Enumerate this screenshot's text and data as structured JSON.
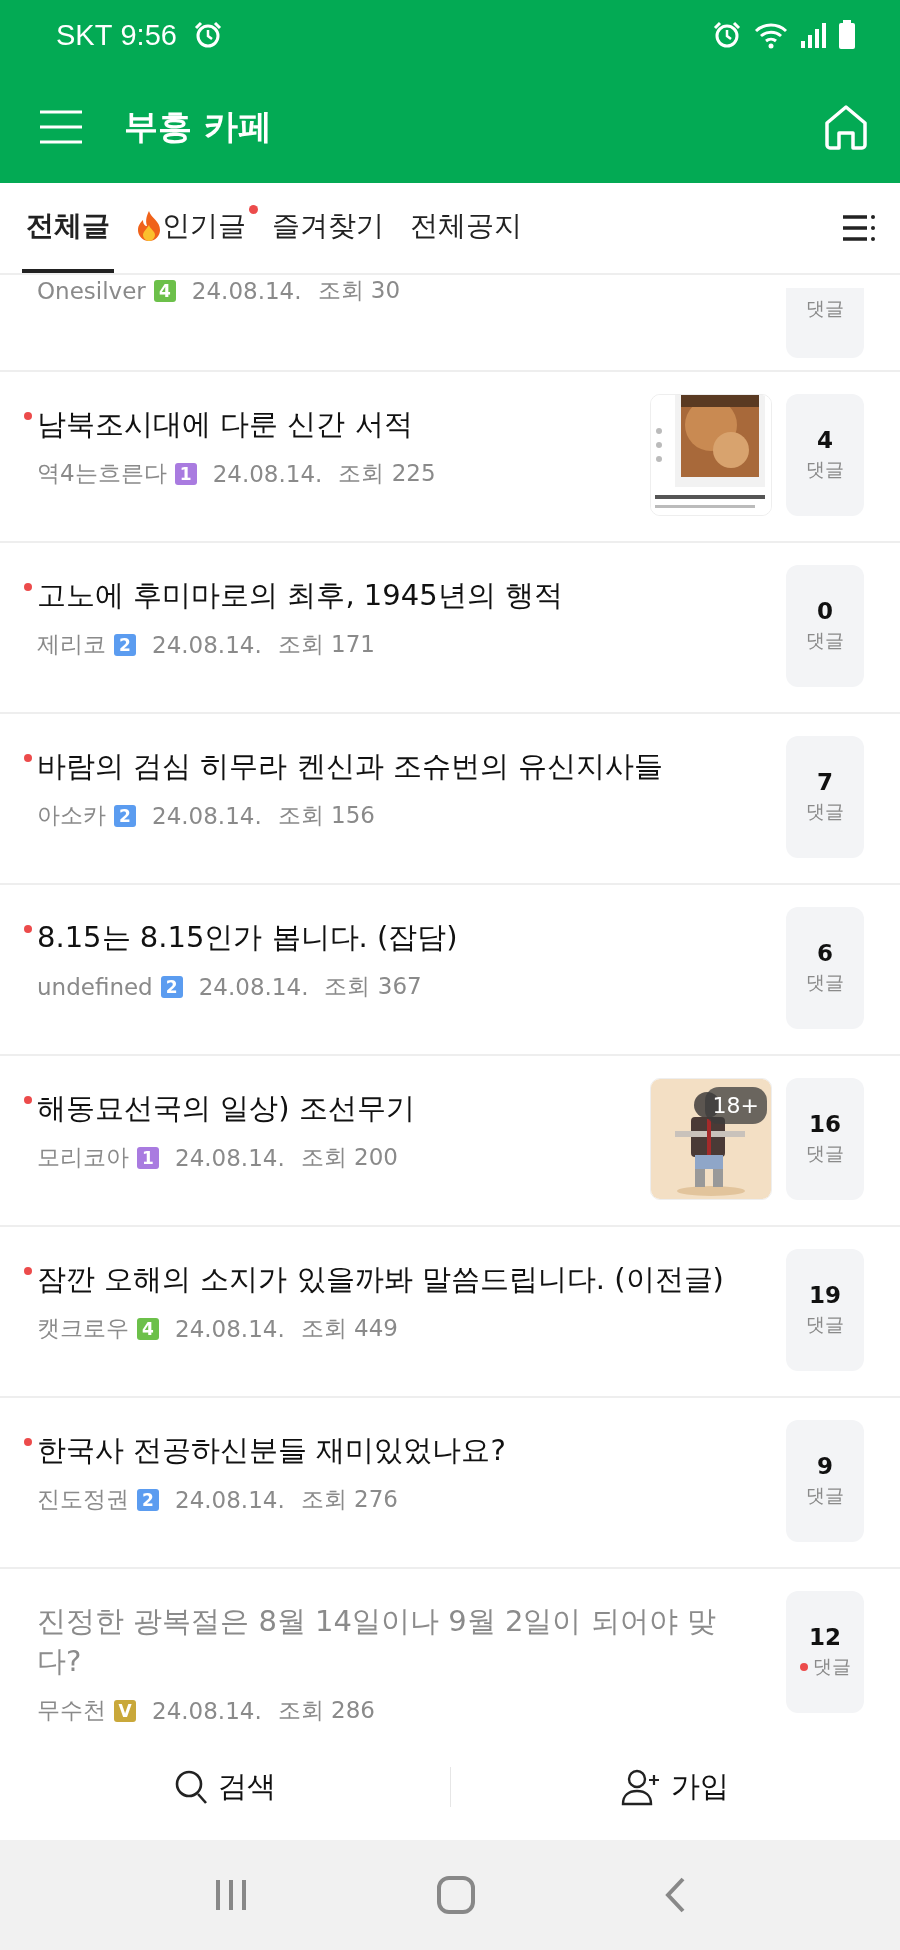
{
  "status_bar": {
    "carrier": "SKT",
    "time": "9:56"
  },
  "header": {
    "title": "부흥 카페"
  },
  "tabs": [
    {
      "label": "전체글",
      "selected": true,
      "kind": "plain",
      "new": false
    },
    {
      "label": "인기글",
      "selected": false,
      "kind": "hot",
      "new": true
    },
    {
      "label": "즐겨찾기",
      "selected": false,
      "kind": "plain",
      "new": false
    },
    {
      "label": "전체공지",
      "selected": false,
      "kind": "plain",
      "new": false
    }
  ],
  "posts": [
    {
      "kind": "partial",
      "author": "Onesilver",
      "badge": {
        "label": "4",
        "color": "#6cc04a"
      },
      "date": "24.08.14.",
      "views": "조회 30",
      "comments_label": "댓글",
      "new_comment": false
    },
    {
      "kind": "full",
      "title": "남북조시대에 다룬 신간 서적",
      "author": "역4는흐른다",
      "badge": {
        "label": "1",
        "color": "#a97be0"
      },
      "date": "24.08.14.",
      "views": "조회 225",
      "comments": "4",
      "comments_label": "댓글",
      "new": true,
      "read": false,
      "new_comment": false
    },
    {
      "kind": "full",
      "title": "고노에 후미마로의 최후, 1945년의 행적",
      "author": "제리코",
      "badge": {
        "label": "2",
        "color": "#5b9cf0"
      },
      "date": "24.08.14.",
      "views": "조회 171",
      "comments": "0",
      "comments_label": "댓글",
      "new": true,
      "read": false,
      "new_comment": false
    },
    {
      "kind": "full",
      "title": "바람의 검심 히무라 켄신과 조슈번의 유신지사들",
      "author": "아소카",
      "badge": {
        "label": "2",
        "color": "#5b9cf0"
      },
      "date": "24.08.14.",
      "views": "조회 156",
      "comments": "7",
      "comments_label": "댓글",
      "new": true,
      "read": false,
      "new_comment": false
    },
    {
      "kind": "full",
      "title": "8.15는 8.15인가 봅니다. (잡담)",
      "author": "undefined",
      "badge": {
        "label": "2",
        "color": "#5b9cf0"
      },
      "date": "24.08.14.",
      "views": "조회 367",
      "comments": "6",
      "comments_label": "댓글",
      "new": true,
      "read": false,
      "new_comment": false
    },
    {
      "kind": "full",
      "title": "해동묘선국의 일상) 조선무기",
      "author": "모리코아",
      "badge": {
        "label": "1",
        "color": "#a97be0"
      },
      "date": "24.08.14.",
      "views": "조회 200",
      "comments": "16",
      "comments_label": "댓글",
      "thumbnail": {
        "kind": "picture",
        "overlay": "18+"
      },
      "new": true,
      "read": false,
      "new_comment": false
    },
    {
      "kind": "full",
      "title": "잠깐 오해의 소지가 있을까봐 말씀드립니다. (이전글)",
      "author": "캣크로우",
      "badge": {
        "label": "4",
        "color": "#6cc04a"
      },
      "date": "24.08.14.",
      "views": "조회 449",
      "comments": "19",
      "comments_label": "댓글",
      "new": true,
      "read": false,
      "new_comment": false
    },
    {
      "kind": "full",
      "title": "한국사 전공하신분들 재미있었나요?",
      "author": "진도정권",
      "badge": {
        "label": "2",
        "color": "#5b9cf0"
      },
      "date": "24.08.14.",
      "views": "조회 276",
      "comments": "9",
      "comments_label": "댓글",
      "new": true,
      "read": false,
      "new_comment": false
    },
    {
      "kind": "full",
      "title": "진정한 광복절은 8월 14일이나 9월 2일이 되어야 맞다?",
      "author": "무수천",
      "badge": {
        "label": "V",
        "color": "#c9a83a"
      },
      "date": "24.08.14.",
      "views": "조회 286",
      "comments": "12",
      "comments_label": "댓글",
      "new": false,
      "read": true,
      "new_comment": true
    }
  ],
  "bottom_bar": [
    {
      "kind": "search",
      "label": "검색"
    },
    {
      "kind": "join",
      "label": "가입"
    }
  ]
}
